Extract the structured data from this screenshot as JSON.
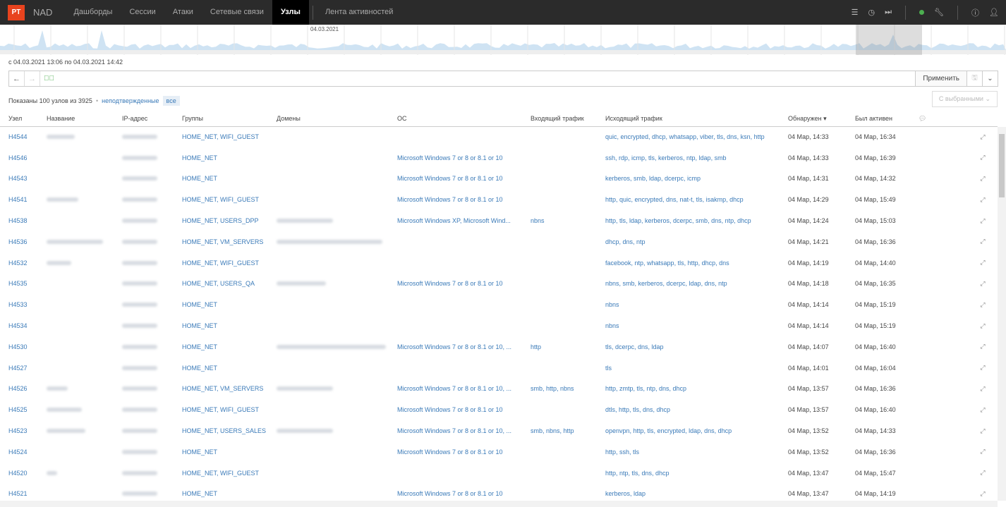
{
  "header": {
    "logo": "PT",
    "product": "NAD",
    "nav": [
      {
        "label": "Дашборды"
      },
      {
        "label": "Сессии"
      },
      {
        "label": "Атаки"
      },
      {
        "label": "Сетевые связи"
      },
      {
        "label": "Узлы",
        "active": true
      },
      {
        "label": "Лента активностей"
      }
    ],
    "icons": [
      "menu-icon",
      "clock-icon",
      "skip-forward-icon",
      "status-dot-icon",
      "wrench-icon",
      "help-icon",
      "user-icon"
    ],
    "status_color": "#4caf50"
  },
  "timeline": {
    "date_label": "04.03.2021"
  },
  "range": "с 04.03.2021 13:06 по 04.03.2021 14:42",
  "filter": {
    "value": "",
    "apply": "Применить"
  },
  "summary": {
    "shown": "Показаны 100 узлов из 3925",
    "unconfirmed": "неподтвержденные",
    "all": "все",
    "with_selected": "С выбранными"
  },
  "columns": [
    "Узел",
    "Название",
    "IP-адрес",
    "Группы",
    "Домены",
    "ОС",
    "Входящий трафик",
    "Исходящий трафик",
    "Обнаружен ▾",
    "Был активен"
  ],
  "rows": [
    {
      "id": "H4544",
      "groups": "HOME_NET, WIFI_GUEST",
      "os": "",
      "in": "",
      "out": "quic, encrypted, dhcp, whatsapp, viber, tls, dns, ksn, http",
      "found": "04 Мар, 14:33",
      "active": "04 Мар, 16:34"
    },
    {
      "id": "H4546",
      "groups": "HOME_NET",
      "os": "Microsoft Windows 7 or 8 or 8.1 or 10",
      "in": "",
      "out": "ssh, rdp, icmp, tls, kerberos, ntp, ldap, smb",
      "found": "04 Мар, 14:33",
      "active": "04 Мар, 16:39"
    },
    {
      "id": "H4543",
      "groups": "HOME_NET",
      "os": "Microsoft Windows 7 or 8 or 8.1 or 10",
      "in": "",
      "out": "kerberos, smb, ldap, dcerpc, icmp",
      "found": "04 Мар, 14:31",
      "active": "04 Мар, 14:32"
    },
    {
      "id": "H4541",
      "groups": "HOME_NET, WIFI_GUEST",
      "os": "Microsoft Windows 7 or 8 or 8.1 or 10",
      "in": "",
      "out": "http, quic, encrypted, dns, nat-t, tls, isakmp, dhcp",
      "found": "04 Мар, 14:29",
      "active": "04 Мар, 15:49"
    },
    {
      "id": "H4538",
      "groups": "HOME_NET, USERS_DPP",
      "os": "Microsoft Windows XP, Microsoft Wind...",
      "in": "nbns",
      "out": "http, tls, ldap, kerberos, dcerpc, smb, dns, ntp, dhcp",
      "found": "04 Мар, 14:24",
      "active": "04 Мар, 15:03"
    },
    {
      "id": "H4536",
      "groups": "HOME_NET, VM_SERVERS",
      "os": "",
      "in": "",
      "out": "dhcp, dns, ntp",
      "found": "04 Мар, 14:21",
      "active": "04 Мар, 16:36"
    },
    {
      "id": "H4532",
      "groups": "HOME_NET, WIFI_GUEST",
      "os": "",
      "in": "",
      "out": "facebook, ntp, whatsapp, tls, http, dhcp, dns",
      "found": "04 Мар, 14:19",
      "active": "04 Мар, 14:40"
    },
    {
      "id": "H4535",
      "groups": "HOME_NET, USERS_QA",
      "os": "Microsoft Windows 7 or 8 or 8.1 or 10",
      "in": "",
      "out": "nbns, smb, kerberos, dcerpc, ldap, dns, ntp",
      "found": "04 Мар, 14:18",
      "active": "04 Мар, 16:35"
    },
    {
      "id": "H4533",
      "groups": "HOME_NET",
      "os": "",
      "in": "",
      "out": "nbns",
      "found": "04 Мар, 14:14",
      "active": "04 Мар, 15:19"
    },
    {
      "id": "H4534",
      "groups": "HOME_NET",
      "os": "",
      "in": "",
      "out": "nbns",
      "found": "04 Мар, 14:14",
      "active": "04 Мар, 15:19"
    },
    {
      "id": "H4530",
      "groups": "HOME_NET",
      "os": "Microsoft Windows 7 or 8 or 8.1 or 10, ...",
      "in": "http",
      "out": "tls, dcerpc, dns, ldap",
      "found": "04 Мар, 14:07",
      "active": "04 Мар, 16:40"
    },
    {
      "id": "H4527",
      "groups": "HOME_NET",
      "os": "",
      "in": "",
      "out": "tls",
      "found": "04 Мар, 14:01",
      "active": "04 Мар, 16:04"
    },
    {
      "id": "H4526",
      "groups": "HOME_NET, VM_SERVERS",
      "os": "Microsoft Windows 7 or 8 or 8.1 or 10, ...",
      "in": "smb, http, nbns",
      "out": "http, zmtp, tls, ntp, dns, dhcp",
      "found": "04 Мар, 13:57",
      "active": "04 Мар, 16:36"
    },
    {
      "id": "H4525",
      "groups": "HOME_NET, WIFI_GUEST",
      "os": "Microsoft Windows 7 or 8 or 8.1 or 10",
      "in": "",
      "out": "dtls, http, tls, dns, dhcp",
      "found": "04 Мар, 13:57",
      "active": "04 Мар, 16:40"
    },
    {
      "id": "H4523",
      "groups": "HOME_NET, USERS_SALES",
      "os": "Microsoft Windows 7 or 8 or 8.1 or 10, ...",
      "in": "smb, nbns, http",
      "out": "openvpn, http, tls, encrypted, ldap, dns, dhcp",
      "found": "04 Мар, 13:52",
      "active": "04 Мар, 14:33"
    },
    {
      "id": "H4524",
      "groups": "HOME_NET",
      "os": "Microsoft Windows 7 or 8 or 8.1 or 10",
      "in": "",
      "out": "http, ssh, tls",
      "found": "04 Мар, 13:52",
      "active": "04 Мар, 16:36"
    },
    {
      "id": "H4520",
      "groups": "HOME_NET, WIFI_GUEST",
      "os": "",
      "in": "",
      "out": "http, ntp, tls, dns, dhcp",
      "found": "04 Мар, 13:47",
      "active": "04 Мар, 15:47"
    },
    {
      "id": "H4521",
      "groups": "HOME_NET",
      "os": "Microsoft Windows 7 or 8 or 8.1 or 10",
      "in": "",
      "out": "kerberos, ldap",
      "found": "04 Мар, 13:47",
      "active": "04 Мар, 14:19"
    }
  ]
}
